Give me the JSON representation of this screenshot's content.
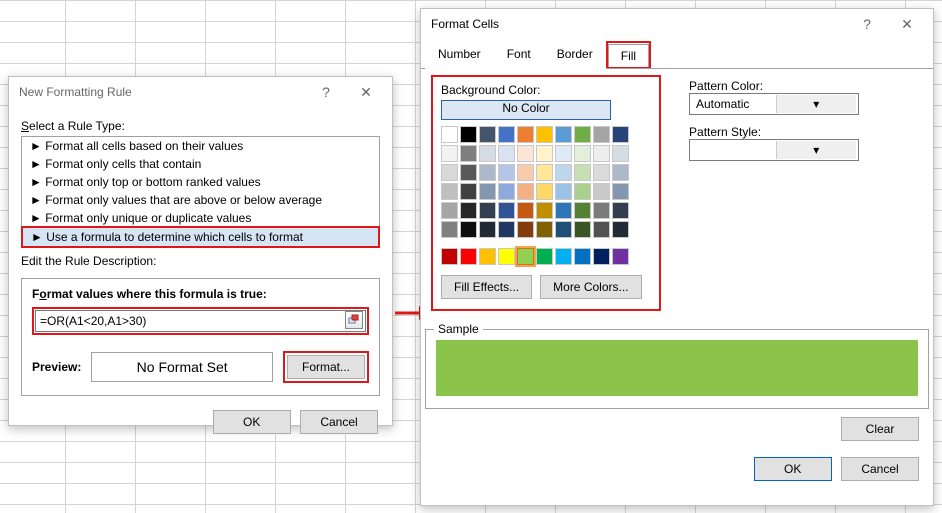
{
  "new_rule": {
    "title": "New Formatting Rule",
    "select_type_label": "Select a Rule Type:",
    "rule_types": [
      "► Format all cells based on their values",
      "► Format only cells that contain",
      "► Format only top or bottom ranked values",
      "► Format only values that are above or below average",
      "► Format only unique or duplicate values",
      "► Use a formula to determine which cells to format"
    ],
    "edit_desc_label": "Edit the Rule Description:",
    "formula_title": "Format values where this formula is true:",
    "formula_value": "=OR(A1<20,A1>30)",
    "preview_label": "Preview:",
    "preview_text": "No Format Set",
    "format_btn": "Format...",
    "ok": "OK",
    "cancel": "Cancel"
  },
  "format_cells": {
    "title": "Format Cells",
    "tabs": [
      "Number",
      "Font",
      "Border",
      "Fill"
    ],
    "active_tab": "Fill",
    "bg_label": "Background Color:",
    "no_color": "No Color",
    "fill_effects": "Fill Effects...",
    "more_colors": "More Colors...",
    "pattern_color_label": "Pattern Color:",
    "pattern_color_value": "Automatic",
    "pattern_style_label": "Pattern Style:",
    "pattern_style_value": "",
    "sample_label": "Sample",
    "clear": "Clear",
    "ok": "OK",
    "cancel": "Cancel",
    "sample_color": "#8ac24a",
    "theme_palette": [
      [
        "#ffffff",
        "#000000",
        "#44546a",
        "#4472c4",
        "#ed7d31",
        "#ffc000",
        "#5b9bd5",
        "#70ad47",
        "#a5a5a5",
        "#264478"
      ],
      [
        "#f2f2f2",
        "#7f7f7f",
        "#d6dce4",
        "#d9e1f2",
        "#fce4d6",
        "#fff2cc",
        "#ddebf7",
        "#e2efda",
        "#ededed",
        "#d6dce4"
      ],
      [
        "#d9d9d9",
        "#595959",
        "#adb9ca",
        "#b4c6e7",
        "#f8cbad",
        "#ffe699",
        "#bdd7ee",
        "#c6e0b4",
        "#dbdbdb",
        "#acb9ca"
      ],
      [
        "#bfbfbf",
        "#404040",
        "#8497b0",
        "#8ea9db",
        "#f4b084",
        "#ffd966",
        "#9bc2e6",
        "#a9d08e",
        "#c9c9c9",
        "#8497b0"
      ],
      [
        "#a6a6a6",
        "#262626",
        "#333f4f",
        "#305496",
        "#c65911",
        "#bf8f00",
        "#2f75b5",
        "#548235",
        "#7b7b7b",
        "#333f4f"
      ],
      [
        "#808080",
        "#0d0d0d",
        "#222b35",
        "#203764",
        "#833c0c",
        "#806000",
        "#1f4e78",
        "#375623",
        "#525252",
        "#222b35"
      ]
    ],
    "standard_palette": [
      "#c00000",
      "#ff0000",
      "#ffc000",
      "#ffff00",
      "#92d050",
      "#00b050",
      "#00b0f0",
      "#0070c0",
      "#002060",
      "#7030a0"
    ],
    "selected_swatch": "#92d050"
  }
}
